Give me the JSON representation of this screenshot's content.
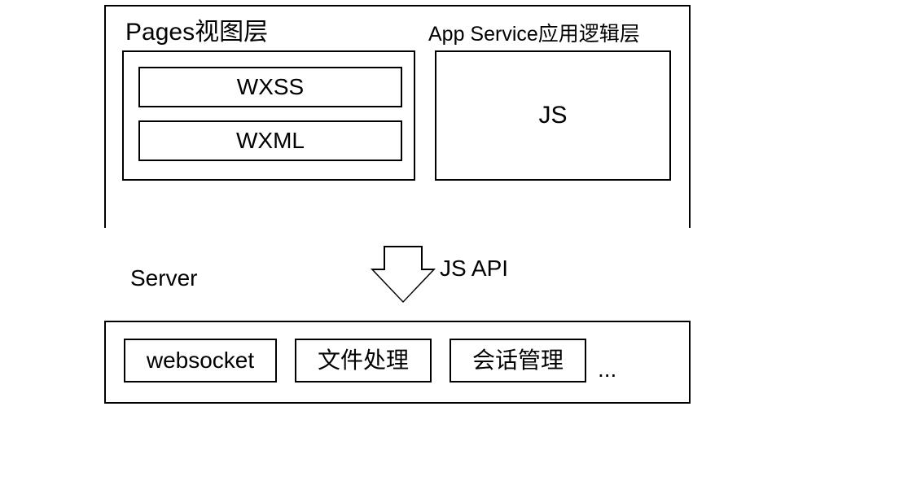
{
  "top": {
    "pagesTitle": "Pages视图层",
    "appServiceTitle": "App Service应用逻辑层",
    "wxss": "WXSS",
    "wxml": "WXML",
    "js": "JS"
  },
  "middle": {
    "jsapi": "JS API",
    "server": "Server"
  },
  "server": {
    "websocket": "websocket",
    "file": "文件处理",
    "session": "会话管理",
    "ellipsis": "..."
  }
}
